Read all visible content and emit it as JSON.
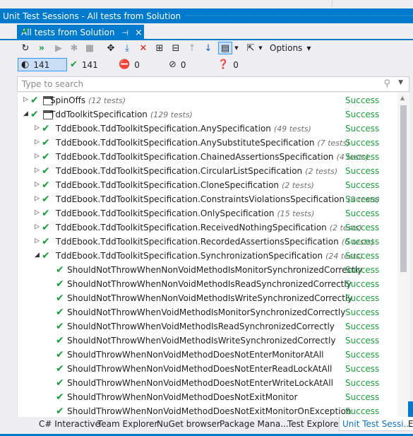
{
  "window": {
    "title": "Unit Test Sessions - All tests from Solution",
    "tab_label": "All tests from Solution",
    "tab_pin": "⊣",
    "tab_close": "×"
  },
  "toolbar": {
    "icons": [
      "refresh-icon",
      "run-all-icon",
      "run-icon",
      "debug-icon",
      "stop-icon",
      "paw-icon",
      "download-icon",
      "delete-icon",
      "expand-all-icon",
      "collapse-all-icon",
      "arrow-up-icon",
      "arrow-down-icon",
      "view-icon",
      "export-icon"
    ],
    "options_label": "Options"
  },
  "counters": {
    "all": "141",
    "passed": "141",
    "failed": "0",
    "ignored": "0",
    "inconclusive": "0"
  },
  "search": {
    "placeholder": "Type to search"
  },
  "tree": [
    {
      "name": "SpinOffs",
      "count": "(12 tests)",
      "status": "Success",
      "level": 0,
      "expanded": false,
      "icon": "folder"
    },
    {
      "name": "TddToolkitSpecification",
      "count": "(129 tests)",
      "status": "Success",
      "level": 0,
      "expanded": true,
      "icon": "project"
    },
    {
      "name": "TddEbook.TddToolkitSpecification.AnySpecification",
      "count": "(49 tests)",
      "status": "Success",
      "level": 1,
      "expanded": false
    },
    {
      "name": "TddEbook.TddToolkitSpecification.AnySubstituteSpecification",
      "count": "(7 tests)",
      "status": "Success",
      "level": 1,
      "expanded": false
    },
    {
      "name": "TddEbook.TddToolkitSpecification.ChainedAssertionsSpecification",
      "count": "(4 tests)",
      "status": "Success",
      "level": 1,
      "expanded": false
    },
    {
      "name": "TddEbook.TddToolkitSpecification.CircularListSpecification",
      "count": "(2 tests)",
      "status": "Success",
      "level": 1,
      "expanded": false
    },
    {
      "name": "TddEbook.TddToolkitSpecification.CloneSpecification",
      "count": "(2 tests)",
      "status": "Success",
      "level": 1,
      "expanded": false
    },
    {
      "name": "TddEbook.TddToolkitSpecification.ConstraintsViolationsSpecification",
      "count": "(3 tests)",
      "status": "Success",
      "level": 1,
      "expanded": false
    },
    {
      "name": "TddEbook.TddToolkitSpecification.OnlySpecification",
      "count": "(15 tests)",
      "status": "Success",
      "level": 1,
      "expanded": false
    },
    {
      "name": "TddEbook.TddToolkitSpecification.ReceivedNothingSpecification",
      "count": "(2 tests)",
      "status": "Success",
      "level": 1,
      "expanded": false
    },
    {
      "name": "TddEbook.TddToolkitSpecification.RecordedAssertionsSpecification",
      "count": "(6 tests)",
      "status": "Success",
      "level": 1,
      "expanded": false
    },
    {
      "name": "TddEbook.TddToolkitSpecification.SynchronizationSpecification",
      "count": "(24 tests)",
      "status": "Success",
      "level": 1,
      "expanded": true
    },
    {
      "name": "ShouldNotThrowWhenNonVoidMethodIsMonitorSynchronizedCorrectly",
      "count": "",
      "status": "Success",
      "level": 2
    },
    {
      "name": "ShouldNotThrowWhenNonVoidMethodIsReadSynchronizedCorrectly",
      "count": "",
      "status": "Success",
      "level": 2
    },
    {
      "name": "ShouldNotThrowWhenNonVoidMethodIsWriteSynchronizedCorrectly",
      "count": "",
      "status": "Success",
      "level": 2
    },
    {
      "name": "ShouldNotThrowWhenVoidMethodIsMonitorSynchronizedCorrectly",
      "count": "",
      "status": "Success",
      "level": 2
    },
    {
      "name": "ShouldNotThrowWhenVoidMethodIsReadSynchronizedCorrectly",
      "count": "",
      "status": "Success",
      "level": 2
    },
    {
      "name": "ShouldNotThrowWhenVoidMethodIsWriteSynchronizedCorrectly",
      "count": "",
      "status": "Success",
      "level": 2
    },
    {
      "name": "ShouldThrowWhenNonVoidMethodDoesNotEnterMonitorAtAll",
      "count": "",
      "status": "Success",
      "level": 2
    },
    {
      "name": "ShouldThrowWhenNonVoidMethodDoesNotEnterReadLockAtAll",
      "count": "",
      "status": "Success",
      "level": 2
    },
    {
      "name": "ShouldThrowWhenNonVoidMethodDoesNotEnterWriteLockAtAll",
      "count": "",
      "status": "Success",
      "level": 2
    },
    {
      "name": "ShouldThrowWhenNonVoidMethodDoesNotExitMonitor",
      "count": "",
      "status": "Success",
      "level": 2
    },
    {
      "name": "ShouldThrowWhenNonVoidMethodDoesNotExitMonitorOnException",
      "count": "",
      "status": "Success",
      "level": 2
    }
  ],
  "bottom_tabs": [
    "C# Interactive",
    "Team Explorer",
    "NuGet browser",
    "Package Mana...",
    "Test Explorer",
    "Unit Test Sessi...",
    "E"
  ],
  "colors": {
    "accent": "#007acc",
    "success": "#1b9c3a",
    "failed": "#e51400",
    "inconclusive": "#1e88e5"
  }
}
